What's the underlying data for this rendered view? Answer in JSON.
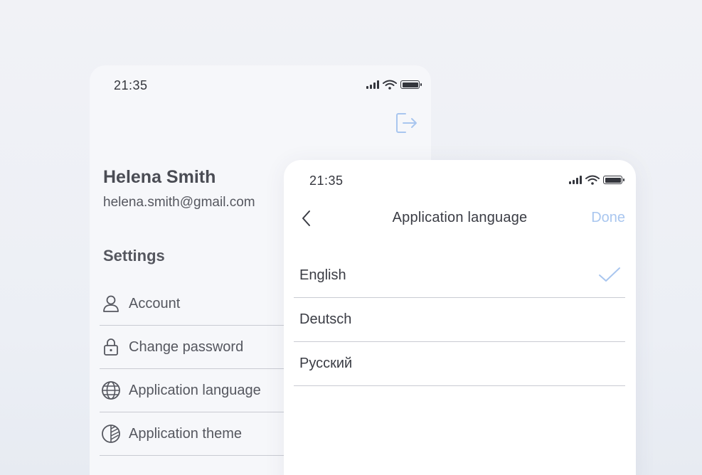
{
  "back_screen": {
    "status_bar": {
      "time": "21:35"
    },
    "profile": {
      "name": "Helena Smith",
      "email": "helena.smith@gmail.com"
    },
    "settings_heading": "Settings",
    "settings_items": [
      {
        "label": "Account",
        "icon": "user-icon"
      },
      {
        "label": "Change password",
        "icon": "lock-icon"
      },
      {
        "label": "Application language",
        "icon": "globe-icon"
      },
      {
        "label": "Application theme",
        "icon": "theme-icon"
      }
    ],
    "logout_icon": "logout-icon"
  },
  "front_screen": {
    "status_bar": {
      "time": "21:35"
    },
    "nav": {
      "title": "Application language",
      "done_label": "Done",
      "back_icon": "chevron-left-icon"
    },
    "languages": [
      {
        "label": "English",
        "selected": true
      },
      {
        "label": "Deutsch",
        "selected": false
      },
      {
        "label": "Русский",
        "selected": false
      }
    ]
  },
  "colors": {
    "accent": "#a9c6ef",
    "text": "#3a3c44",
    "divider": "#c9cbd2",
    "background": "#f1f2f6"
  }
}
